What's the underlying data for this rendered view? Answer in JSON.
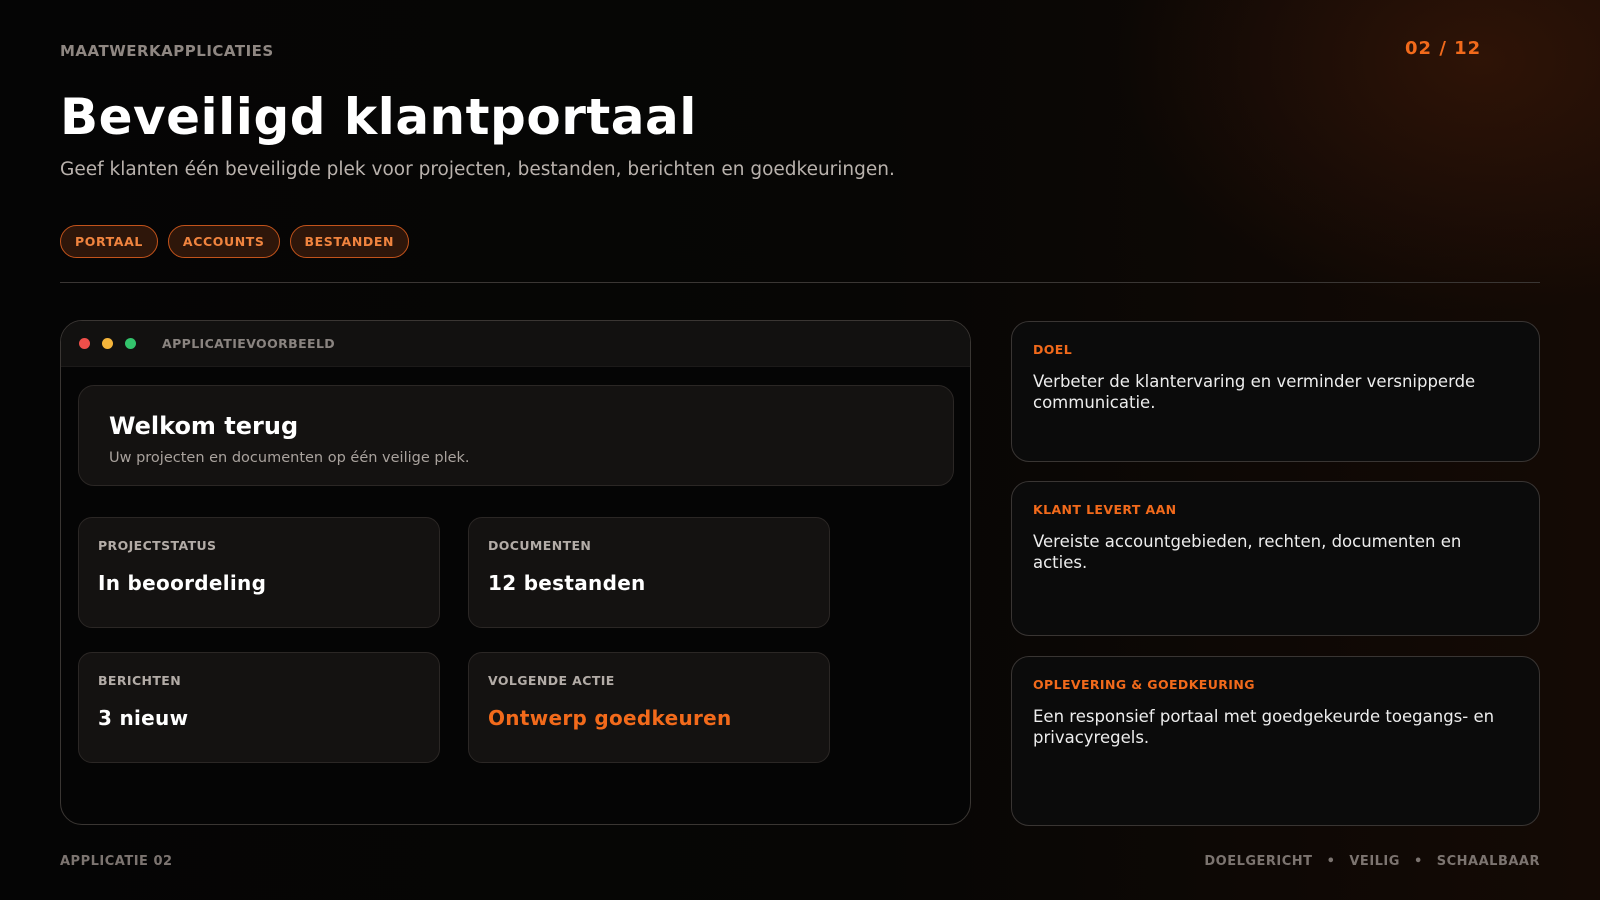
{
  "header": {
    "eyebrow": "MAATWERKAPPLICATIES",
    "page_counter": "02 / 12",
    "title": "Beveiligd klantportaal",
    "subtitle": "Geef klanten één beveiligde plek voor projecten, bestanden, berichten en goedkeuringen.",
    "tags": [
      "PORTAAL",
      "ACCOUNTS",
      "BESTANDEN"
    ]
  },
  "app_preview": {
    "window_label": "APPLICATIEVOORBEELD",
    "window_dots": [
      "red",
      "yellow",
      "green"
    ],
    "welcome": {
      "title": "Welkom terug",
      "subtitle": "Uw projecten en documenten op één veilige plek."
    },
    "stats": [
      {
        "label": "PROJECTSTATUS",
        "value": "In beoordeling"
      },
      {
        "label": "DOCUMENTEN",
        "value": "12 bestanden"
      },
      {
        "label": "BERICHTEN",
        "value": "3 nieuw"
      },
      {
        "label": "VOLGENDE ACTIE",
        "value": "Ontwerp goedkeuren"
      }
    ]
  },
  "info_cards": [
    {
      "label": "DOEL",
      "text": "Verbeter de klantervaring en verminder versnipperde communicatie."
    },
    {
      "label": "KLANT LEVERT AAN",
      "text": "Vereiste accountgebieden, rechten, documenten en acties."
    },
    {
      "label": "OPLEVERING & GOEDKEURING",
      "text": "Een responsief portaal met goedgekeurde toegangs- en privacyregels."
    }
  ],
  "footer": {
    "left": "APPLICATIE 02",
    "right_items": [
      "DOELGERICHT",
      "VEILIG",
      "SCHAALBAAR"
    ],
    "separator": "•"
  },
  "colors": {
    "accent": "#f26a1b",
    "background": "#050505",
    "card": "#141211",
    "dot_red": "#ef4f4a",
    "dot_yellow": "#f5b53b",
    "dot_green": "#33c46c"
  }
}
